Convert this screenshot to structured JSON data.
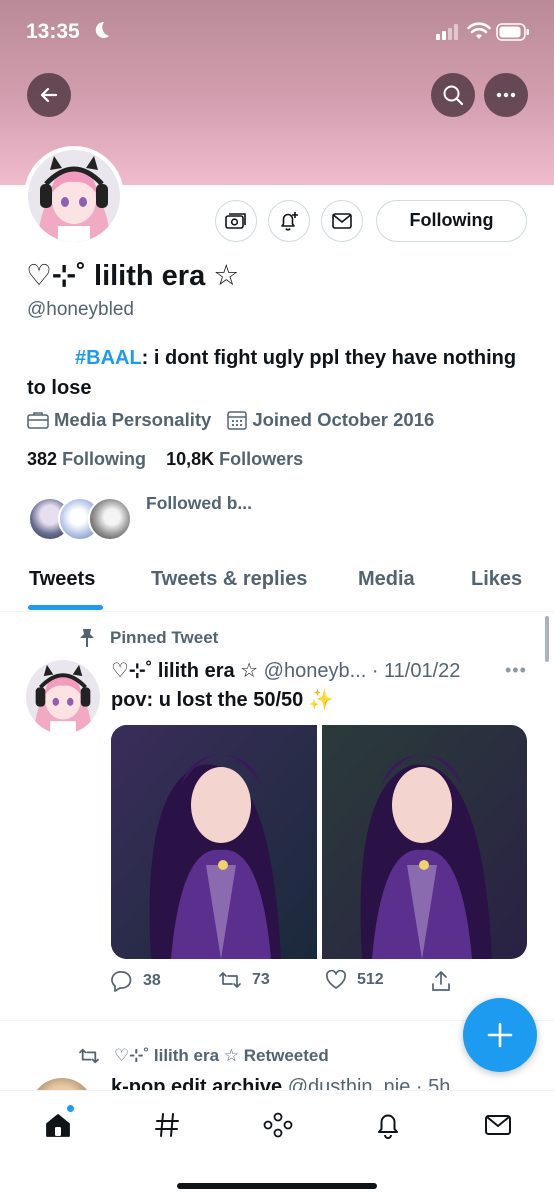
{
  "status_bar": {
    "time": "13:35"
  },
  "profile": {
    "display_name": "♡⊹˚ lilith era ☆",
    "handle": "@honeybled",
    "bio_hashtag": "#BAAL",
    "bio_text": ": i dont fight ugly ppl they have nothing to lose",
    "category": "Media Personality",
    "joined": "Joined October 2016",
    "following_count": "382",
    "following_label": "Following",
    "followers_count": "10,8K",
    "followers_label": "Followers",
    "followed_by": "Followed b..."
  },
  "follow_button": {
    "label": "Following"
  },
  "tabs": [
    {
      "label": "Tweets",
      "active": true
    },
    {
      "label": "Tweets & replies",
      "active": false
    },
    {
      "label": "Media",
      "active": false
    },
    {
      "label": "Likes",
      "active": false
    }
  ],
  "pinned_tweet": {
    "pinned_label": "Pinned Tweet",
    "author_name": "♡⊹˚ lilith era ☆",
    "author_handle": "@honeyb...",
    "date": "· 11/01/22",
    "text": "pov: u lost the 50/50 ✨",
    "replies": "38",
    "retweets": "73",
    "likes": "512"
  },
  "retweet": {
    "label": "♡⊹˚ lilith era ☆ Retweeted",
    "next_name": "k-pop edit archive",
    "next_handle": "@dusthin_nie · 5h"
  },
  "colors": {
    "accent": "#1d9bf0",
    "banner": "#d49fb0",
    "muted": "#536471"
  }
}
